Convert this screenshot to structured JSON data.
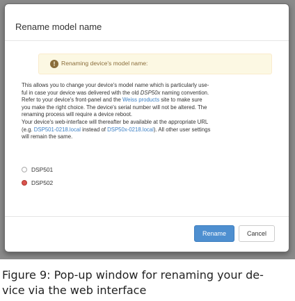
{
  "dialog": {
    "title": "Rename model name",
    "warning": "Renaming device's model name:",
    "warning_icon": "exclamation-circle-icon",
    "body": {
      "p1_a": "This allows you to change your device's model name which is particularly use-",
      "p1_b": "ful in case your device was delivered with the old ",
      "p1_b_italic": "DSP50x",
      "p1_b_end": " naming convention.",
      "p2_a": "Refer to your device's front-panel and the ",
      "p2_a_link": "Weiss products",
      "p2_a_end": " site to make sure",
      "p3": "you make the right choice. The device's serial number will not be altered. The",
      "p4": "renaming process will require a device reboot.",
      "p5": "Your device's web-interface will thereafter be available at the appropriate URL",
      "p6_a": "(e.g. ",
      "p6_link1": "DSP501-0218.local",
      "p6_mid": " instead of ",
      "p6_link2": "DSP50x-0218.local",
      "p6_end": "). All other user settings",
      "p7": "will remain the same."
    },
    "options": [
      {
        "label": "DSP501",
        "selected": false
      },
      {
        "label": "DSP502",
        "selected": true
      }
    ],
    "buttons": {
      "rename": "Rename",
      "cancel": "Cancel"
    }
  },
  "caption": {
    "line1": "Figure 9:  Pop-up window for renaming your de-",
    "line2": "vice via the web interface"
  }
}
